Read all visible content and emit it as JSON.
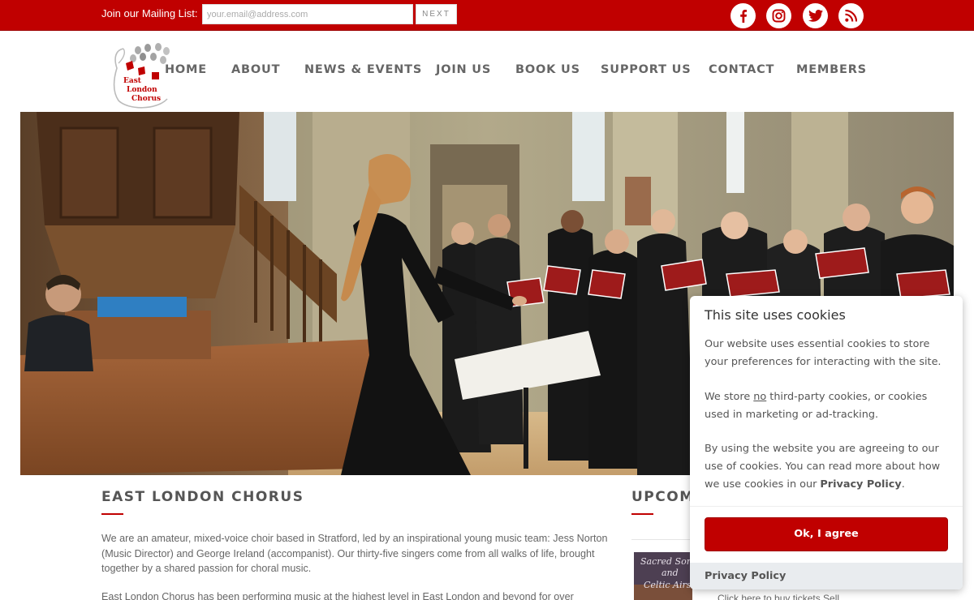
{
  "topbar": {
    "mailing_label": "Join our Mailing List:",
    "email_placeholder": "your.email@address.com",
    "next_label": "NEXT",
    "social_icons": [
      "facebook-icon",
      "instagram-icon",
      "twitter-icon",
      "rss-icon"
    ]
  },
  "logo": {
    "line1": "East",
    "line2": "London",
    "line3": "Chorus"
  },
  "nav": {
    "items": [
      "HOME",
      "ABOUT",
      "NEWS & EVENTS",
      "JOIN US",
      "BOOK US",
      "SUPPORT US",
      "CONTACT",
      "MEMBERS"
    ]
  },
  "main": {
    "title": "EAST LONDON CHORUS",
    "para1": "We are an amateur, mixed-voice choir based in Stratford, led by an inspirational young music team: Jess Norton (Music Director) and George Ireland (accompanist). Our thirty-five singers come from all walks of life, brought together by a shared passion for choral music.",
    "para2": "East London Chorus has been performing music at the highest level in East London and beyond for over"
  },
  "upcoming": {
    "title": "UPCOMING",
    "event_thumb_text_1": "Sacred Songs",
    "event_thumb_text_2": "and",
    "event_thumb_text_3": "Celtic Airs",
    "event_link": "Click here to buy tickets Sell"
  },
  "cookie": {
    "title": "This site uses cookies",
    "p1": "Our website uses essential cookies to store your preferences for interacting with the site.",
    "p2_before": "We store ",
    "p2_emph": "no",
    "p2_after": " third-party cookies, or cookies used in marketing or ad-tracking.",
    "p3_before": "By using the website you are agreeing to our use of cookies. You can read more about how we use cookies in our ",
    "p3_link": "Privacy Policy",
    "p3_after": ".",
    "agree_label": "Ok, I agree",
    "footer_link": "Privacy Policy"
  },
  "colors": {
    "brand_red": "#c00000",
    "text_grey": "#555555"
  }
}
